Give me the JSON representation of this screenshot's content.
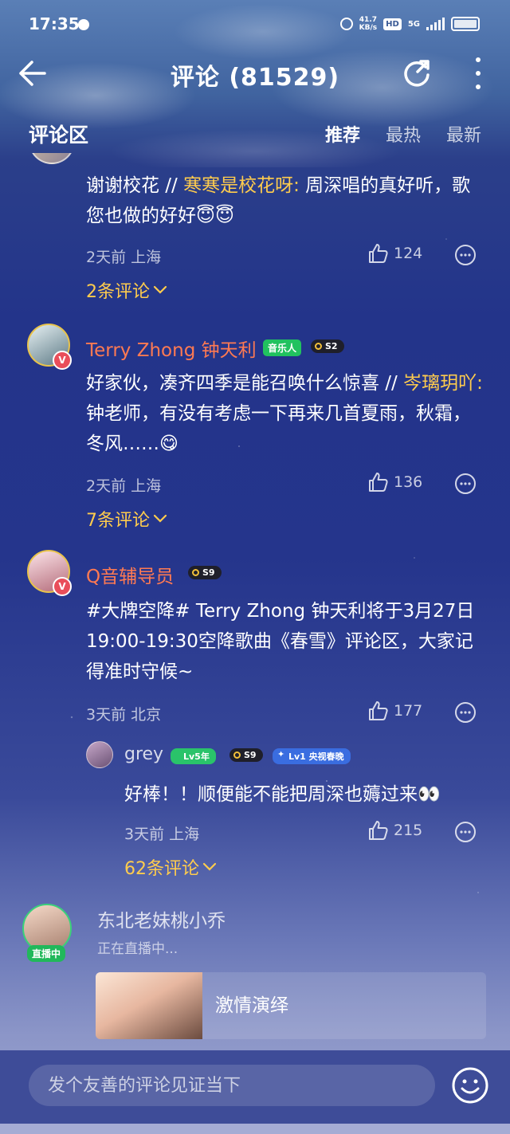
{
  "status_bar": {
    "time": "17:35",
    "speed_value": "41.7",
    "speed_unit": "KB/s",
    "hd": "HD",
    "network": "5G"
  },
  "header": {
    "title": "评论 (81529)"
  },
  "section": {
    "title": "评论区",
    "tabs": [
      "推荐",
      "最热",
      "最新"
    ],
    "active_tab": "推荐"
  },
  "comments": [
    {
      "text_prefix": "谢谢校花 // ",
      "mention": "寒寒是校花呀:",
      "text_suffix": " 周深唱的真好听，歌您也做的好好😇😇",
      "time": "2天前",
      "location": "上海",
      "likes": "124",
      "replies_label": "2条评论"
    },
    {
      "username": "Terry Zhong 钟天利",
      "badge": "音乐人",
      "level": "S2",
      "text_prefix": "好家伙，凑齐四季是能召唤什么惊喜 // ",
      "mention": "岑璃玥吖:",
      "text_suffix": " 钟老师，有没有考虑一下再来几首夏雨，秋霜，冬风……😋",
      "time": "2天前",
      "location": "上海",
      "likes": "136",
      "replies_label": "7条评论"
    },
    {
      "username": "Q音辅导员",
      "level": "S9",
      "text": "#大牌空降# Terry Zhong 钟天利将于3月27日19:00-19:30空降歌曲《春雪》评论区，大家记得准时守候~",
      "time": "3天前",
      "location": "北京",
      "likes": "177",
      "reply": {
        "username": "grey",
        "lv_badge": "Lv5年",
        "level": "S9",
        "lv1_badge": "Lv1 央视春晚",
        "text": "好棒！！顺便能不能把周深也薅过来👀",
        "time": "3天前",
        "location": "上海",
        "likes": "215"
      },
      "replies_label": "62条评论"
    }
  ],
  "live": {
    "name": "东北老妹桃小乔",
    "tag": "直播中",
    "status": "正在直播中...",
    "card_title": "激情演绎"
  },
  "input": {
    "placeholder": "发个友善的评论见证当下"
  },
  "colors": {
    "mention": "#ffcc4d",
    "username": "#ff7a52",
    "music_badge": "#21c25f",
    "bottom_bar": "#3e4c98"
  }
}
